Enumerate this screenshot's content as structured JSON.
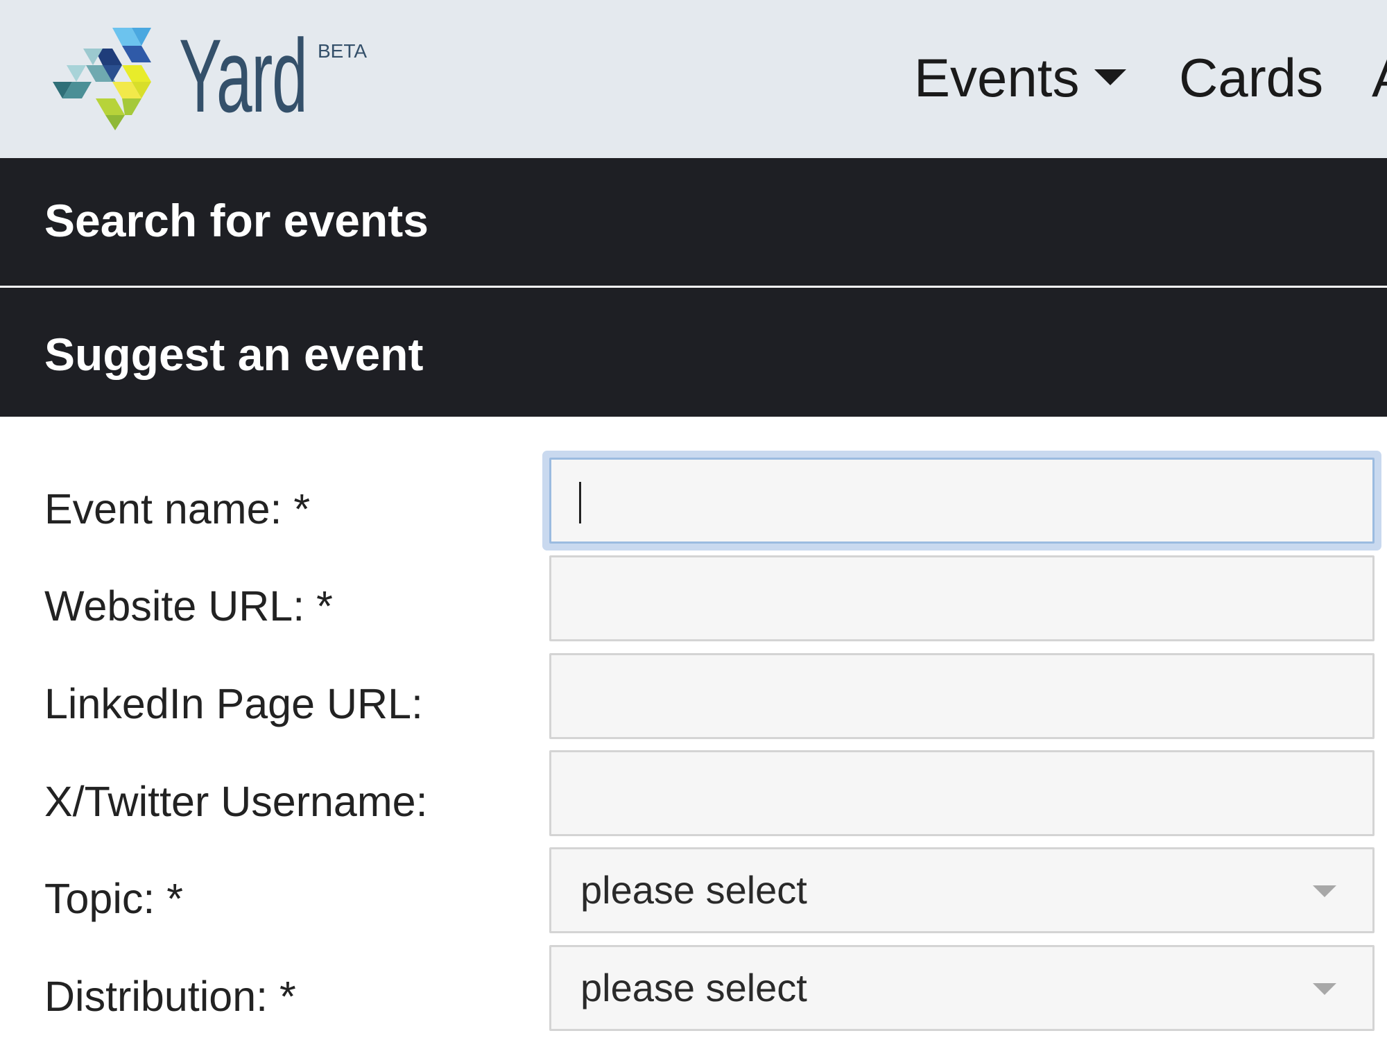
{
  "header": {
    "logo_text": "Yard",
    "logo_badge": "BETA",
    "nav": {
      "events_label": "Events",
      "cards_label": "Cards",
      "more_label": "A"
    }
  },
  "sections": {
    "search_title": "Search for events",
    "suggest_title": "Suggest an event"
  },
  "form": {
    "fields": [
      {
        "label": "Event name: *",
        "value": ""
      },
      {
        "label": "Website URL: *",
        "value": ""
      },
      {
        "label": "LinkedIn Page URL:",
        "value": ""
      },
      {
        "label": "X/Twitter Username:",
        "value": ""
      },
      {
        "label": "Topic: *",
        "selected": "please select"
      },
      {
        "label": "Distribution: *",
        "selected": "please select"
      }
    ]
  },
  "colors": {
    "header_bg": "#e4e9ee",
    "bar_bg": "#1e1f24",
    "brand_text": "#34506a",
    "focus_ring": "#c9d9ef"
  }
}
